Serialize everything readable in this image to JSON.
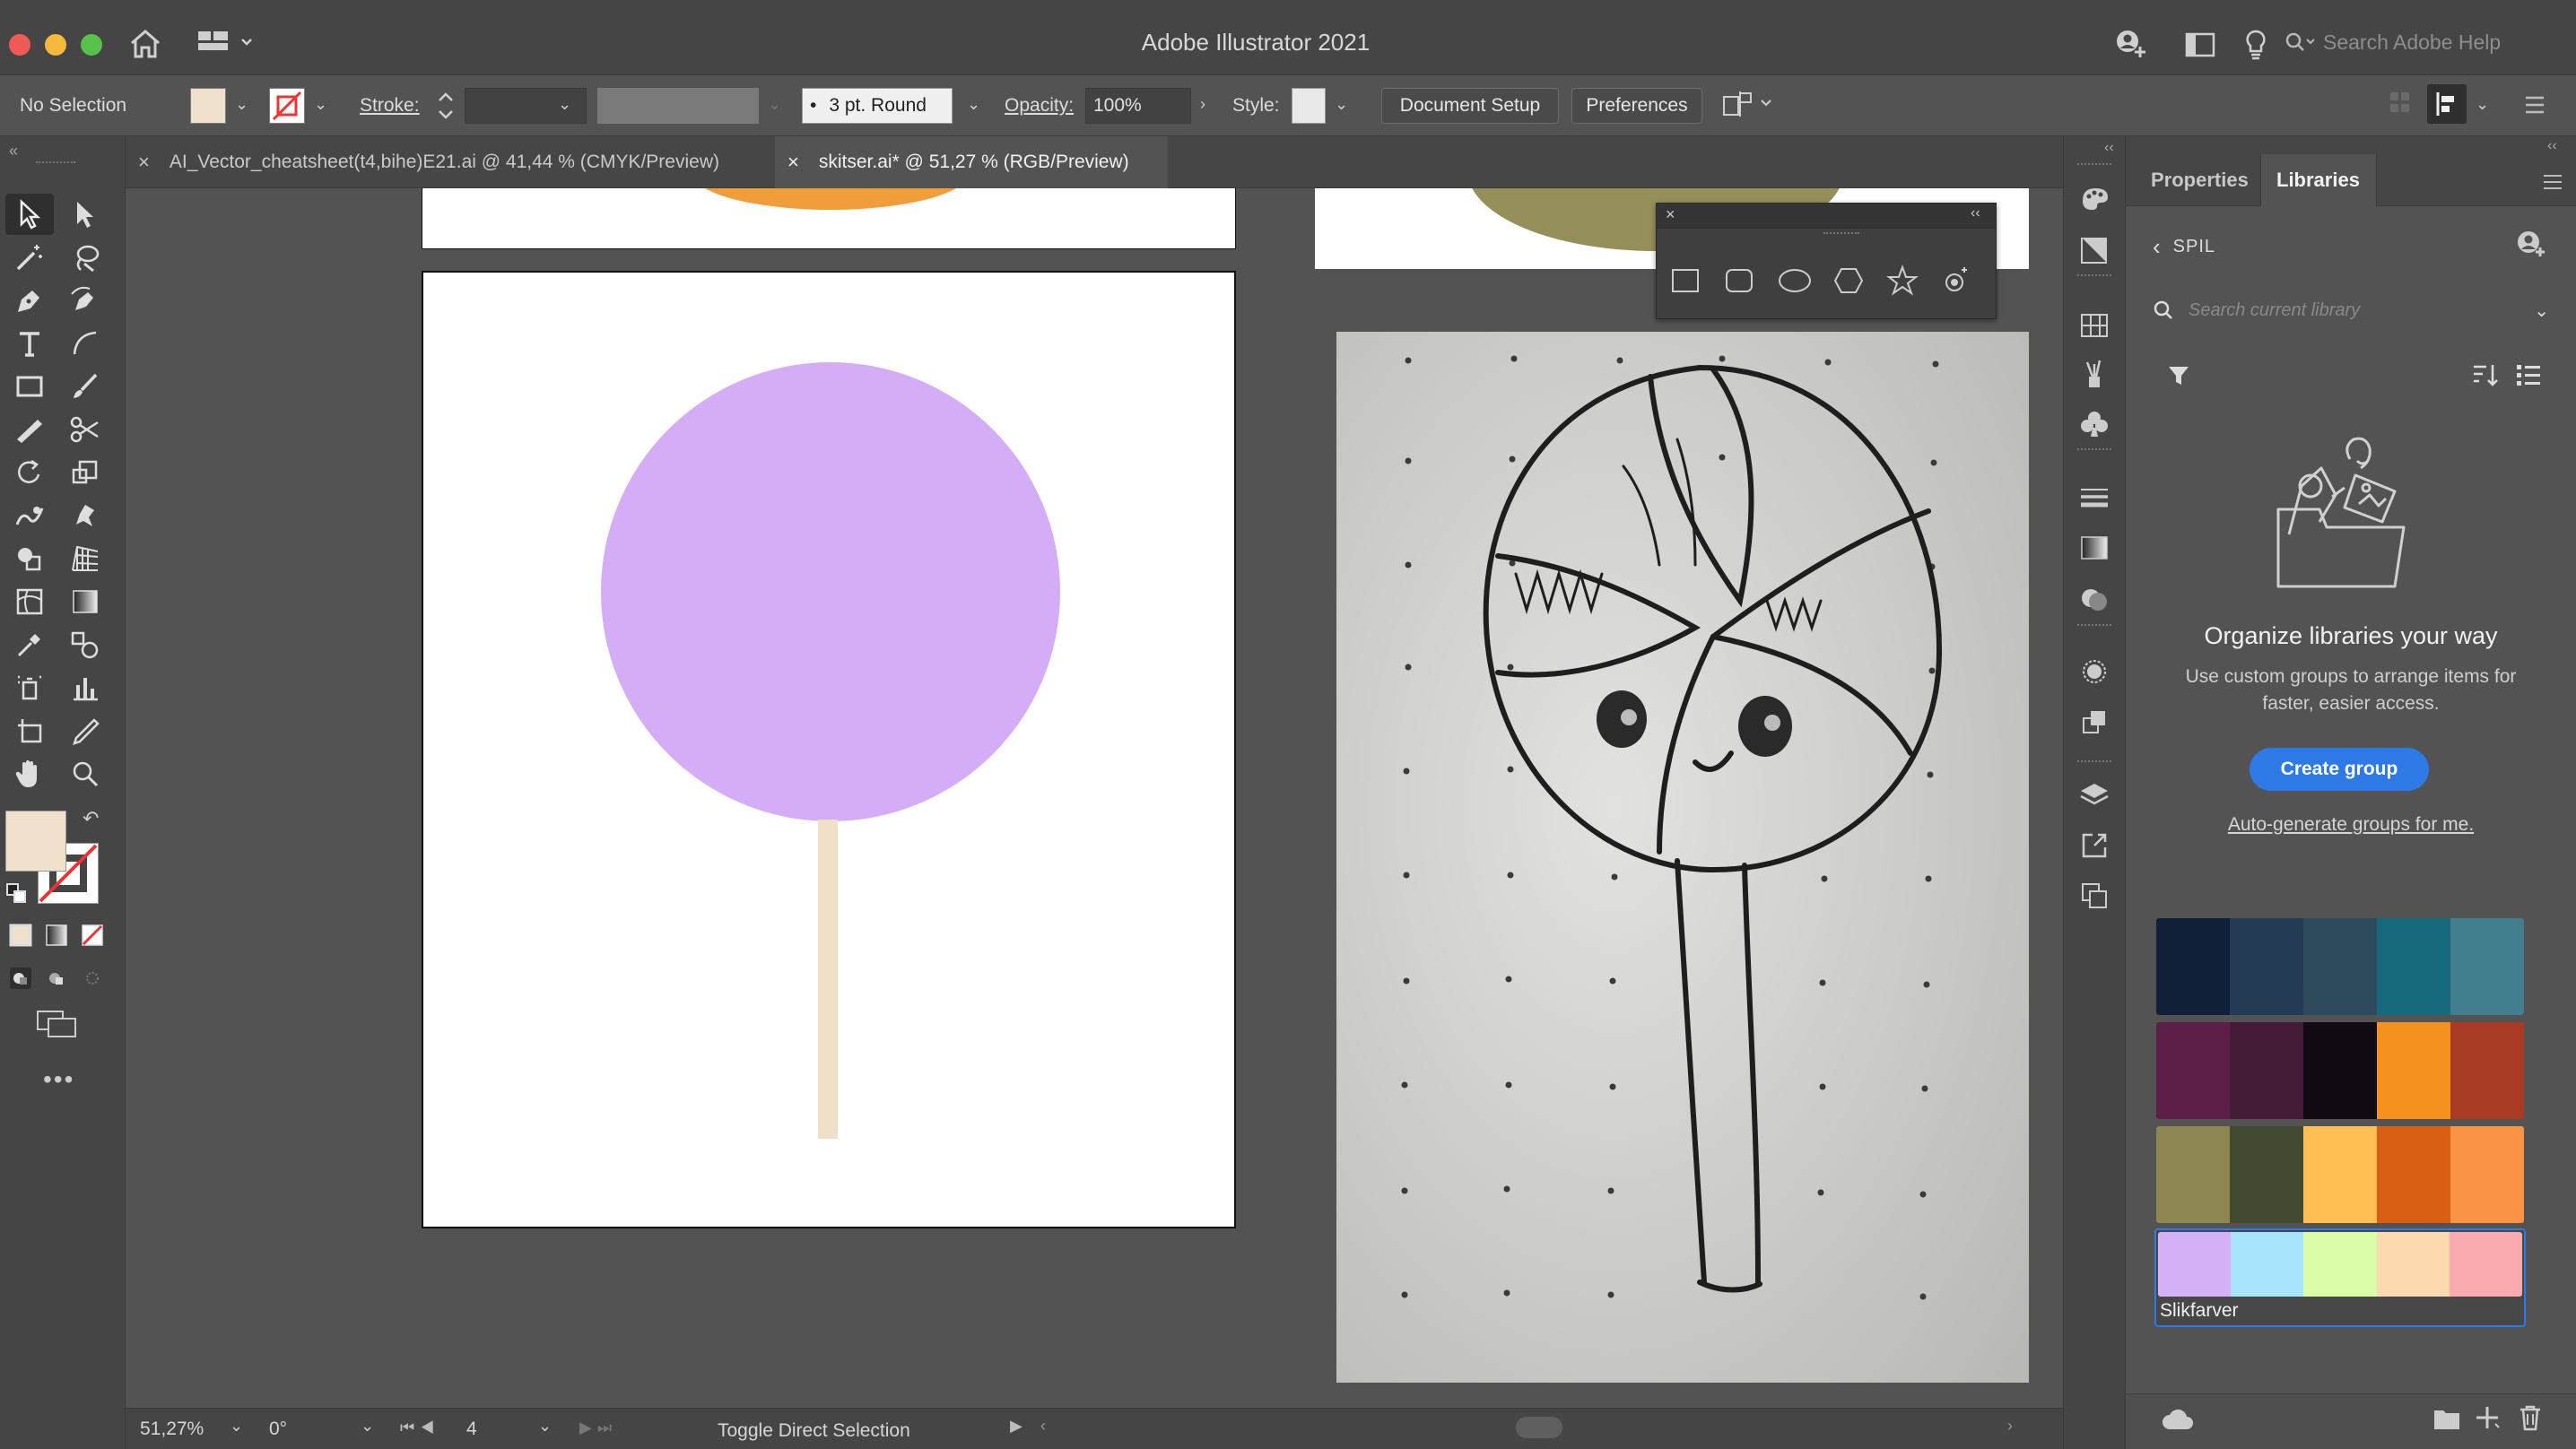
{
  "app": {
    "title": "Adobe Illustrator 2021",
    "search_placeholder": "Search Adobe Help"
  },
  "controlbar": {
    "selection": "No Selection",
    "stroke_label": "Stroke:",
    "brush": "3 pt. Round",
    "opacity_label": "Opacity:",
    "opacity_value": "100%",
    "style_label": "Style:",
    "document_setup": "Document Setup",
    "preferences": "Preferences"
  },
  "tabs": [
    {
      "label": "AI_Vector_cheatsheet(t4,bihe)E21.ai @ 41,44 % (CMYK/Preview)",
      "active": false
    },
    {
      "label": "skitser.ai* @ 51,27 % (RGB/Preview)",
      "active": true
    }
  ],
  "status": {
    "zoom": "51,27%",
    "rotation": "0°",
    "artboard": "4",
    "tool_hint": "Toggle Direct Selection"
  },
  "panel": {
    "tabs": [
      "Properties",
      "Libraries"
    ],
    "active_tab": "Libraries",
    "library_name": "SPIL",
    "search_placeholder": "Search current library",
    "heading": "Organize libraries your way",
    "description": "Use custom groups to arrange items for faster, easier access.",
    "create_group": "Create group",
    "auto_generate": "Auto-generate groups for me.",
    "swatch_groups": [
      {
        "colors": [
          "#102039",
          "#233b55",
          "#2e4b5e",
          "#17697d",
          "#437e8f"
        ],
        "label": ""
      },
      {
        "colors": [
          "#5c1f48",
          "#431b37",
          "#120a13",
          "#f5921f",
          "#a93a23"
        ],
        "label": ""
      },
      {
        "colors": [
          "#8e8751",
          "#434a32",
          "#ffbf55",
          "#d85e13",
          "#fb9345"
        ],
        "label": ""
      },
      {
        "colors": [
          "#d5b2f7",
          "#a8e4fb",
          "#dbfda9",
          "#fcd9ae",
          "#f9abb0"
        ],
        "label": "Slikfarver"
      }
    ]
  },
  "colors": {
    "fill": "#f0e1cc",
    "lollipop_head": "#d5adf7",
    "lollipop_stick": "#f0e0c8",
    "accent_blue": "#2d7ae6"
  }
}
